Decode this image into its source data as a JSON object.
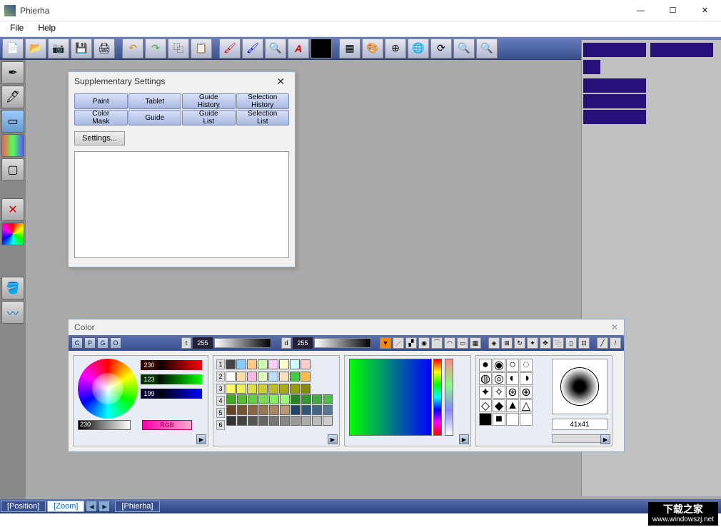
{
  "app": {
    "title": "Phierha"
  },
  "menu": {
    "file": "File",
    "help": "Help"
  },
  "winbtns": {
    "min": "—",
    "max": "☐",
    "close": "✕"
  },
  "toolbar": [
    "new-file",
    "open-file",
    "camera",
    "save",
    "print",
    "undo",
    "redo",
    "copy",
    "paste",
    "brush-red",
    "brush-blue",
    "zoom",
    "text-a",
    "color-black",
    "layer",
    "palette",
    "target",
    "globe",
    "rotate",
    "zoom-in",
    "zoom-out"
  ],
  "leftTools": [
    "pen-tool",
    "brush-tool",
    "rect-select",
    "gradient-tool",
    "shape-tool",
    "deselect",
    "color-mix",
    "paint-bucket",
    "smudge"
  ],
  "supp": {
    "title": "Supplementary Settings",
    "tabs": [
      "Paint",
      "Tablet",
      "Guide\nHistory",
      "Selection\nHistory",
      "Color\nMask",
      "Guide",
      "Guide\nList",
      "Selection\nList"
    ],
    "settingsBtn": "Settings..."
  },
  "colorPanel": {
    "title": "Color",
    "modeTabs": [
      "C",
      "P",
      "G",
      "O"
    ],
    "t_label": "t",
    "t_value": "255",
    "d_label": "d",
    "d_value": "255",
    "rgb": {
      "r": "230",
      "g": "123",
      "b": "199"
    },
    "gray": "230",
    "rgbBtn": "RGB",
    "swatchNums": [
      "1",
      "2",
      "3",
      "4",
      "5",
      "6"
    ],
    "brushSize": "41x41"
  },
  "status": {
    "position": "[Position]",
    "zoom": "[Zoom]",
    "name": "[Phierha]"
  },
  "watermark": {
    "line1": "下载之家",
    "line2": "www.windowszj.net"
  }
}
